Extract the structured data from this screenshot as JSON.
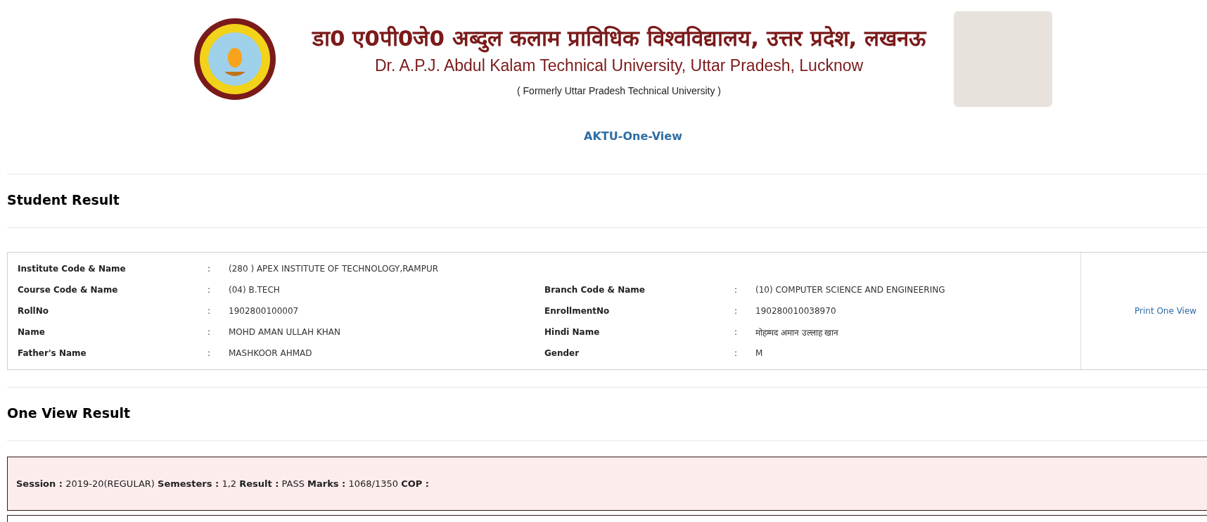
{
  "header": {
    "title_hindi": "डा0 ए0पी0जे0 अब्दुल कलाम प्राविधिक विश्वविद्यालय, उत्तर प्रदेश, लखनऊ",
    "title_english": "Dr. A.P.J. Abdul Kalam Technical University, Uttar Pradesh, Lucknow",
    "subtitle": "( Formerly Uttar Pradesh Technical University )",
    "app_name": "AKTU-One-View"
  },
  "student_result": {
    "heading": "Student Result",
    "rows": [
      [
        {
          "label": "Institute Code & Name",
          "value": "(280 ) APEX INSTITUTE OF TECHNOLOGY,RAMPUR"
        }
      ],
      [
        {
          "label": "Course Code & Name",
          "value": "(04) B.TECH"
        },
        {
          "label": "Branch Code & Name",
          "value": "(10) COMPUTER SCIENCE AND ENGINEERING"
        }
      ],
      [
        {
          "label": "RollNo",
          "value": "1902800100007"
        },
        {
          "label": "EnrollmentNo",
          "value": "190280010038970"
        }
      ],
      [
        {
          "label": "Name",
          "value": "MOHD AMAN ULLAH KHAN"
        },
        {
          "label": "Hindi Name",
          "value": "मोहम्मद अमान उल्लाह खान"
        }
      ],
      [
        {
          "label": "Father's Name",
          "value": "MASHKOOR AHMAD"
        },
        {
          "label": "Gender",
          "value": "M"
        }
      ]
    ],
    "separator": ":",
    "print_link": "Print One View"
  },
  "one_view_result": {
    "heading": "One View Result",
    "sessions": [
      "**Session :** 2019-20(REGULAR) **Semesters :** 1,2 **Result :** PASS **Marks :** 1068/1350 **COP :**"
    ]
  }
}
